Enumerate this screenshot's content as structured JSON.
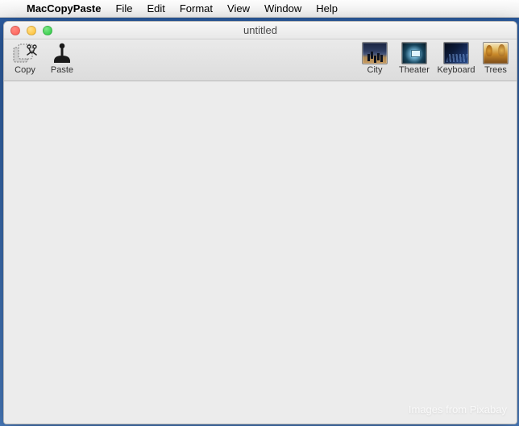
{
  "menubar": {
    "app": "MacCopyPaste",
    "items": [
      "File",
      "Edit",
      "Format",
      "View",
      "Window",
      "Help"
    ]
  },
  "window": {
    "title": "untitled",
    "watermark": "Images from Pixabay"
  },
  "toolbar": {
    "left": [
      {
        "name": "copy",
        "label": "Copy",
        "icon": "copy-icon"
      },
      {
        "name": "paste",
        "label": "Paste",
        "icon": "paste-icon"
      }
    ],
    "right": [
      {
        "name": "city",
        "label": "City",
        "thumb": "city"
      },
      {
        "name": "theater",
        "label": "Theater",
        "thumb": "theater"
      },
      {
        "name": "keyboard",
        "label": "Keyboard",
        "thumb": "keyboard"
      },
      {
        "name": "trees",
        "label": "Trees",
        "thumb": "trees"
      }
    ]
  }
}
